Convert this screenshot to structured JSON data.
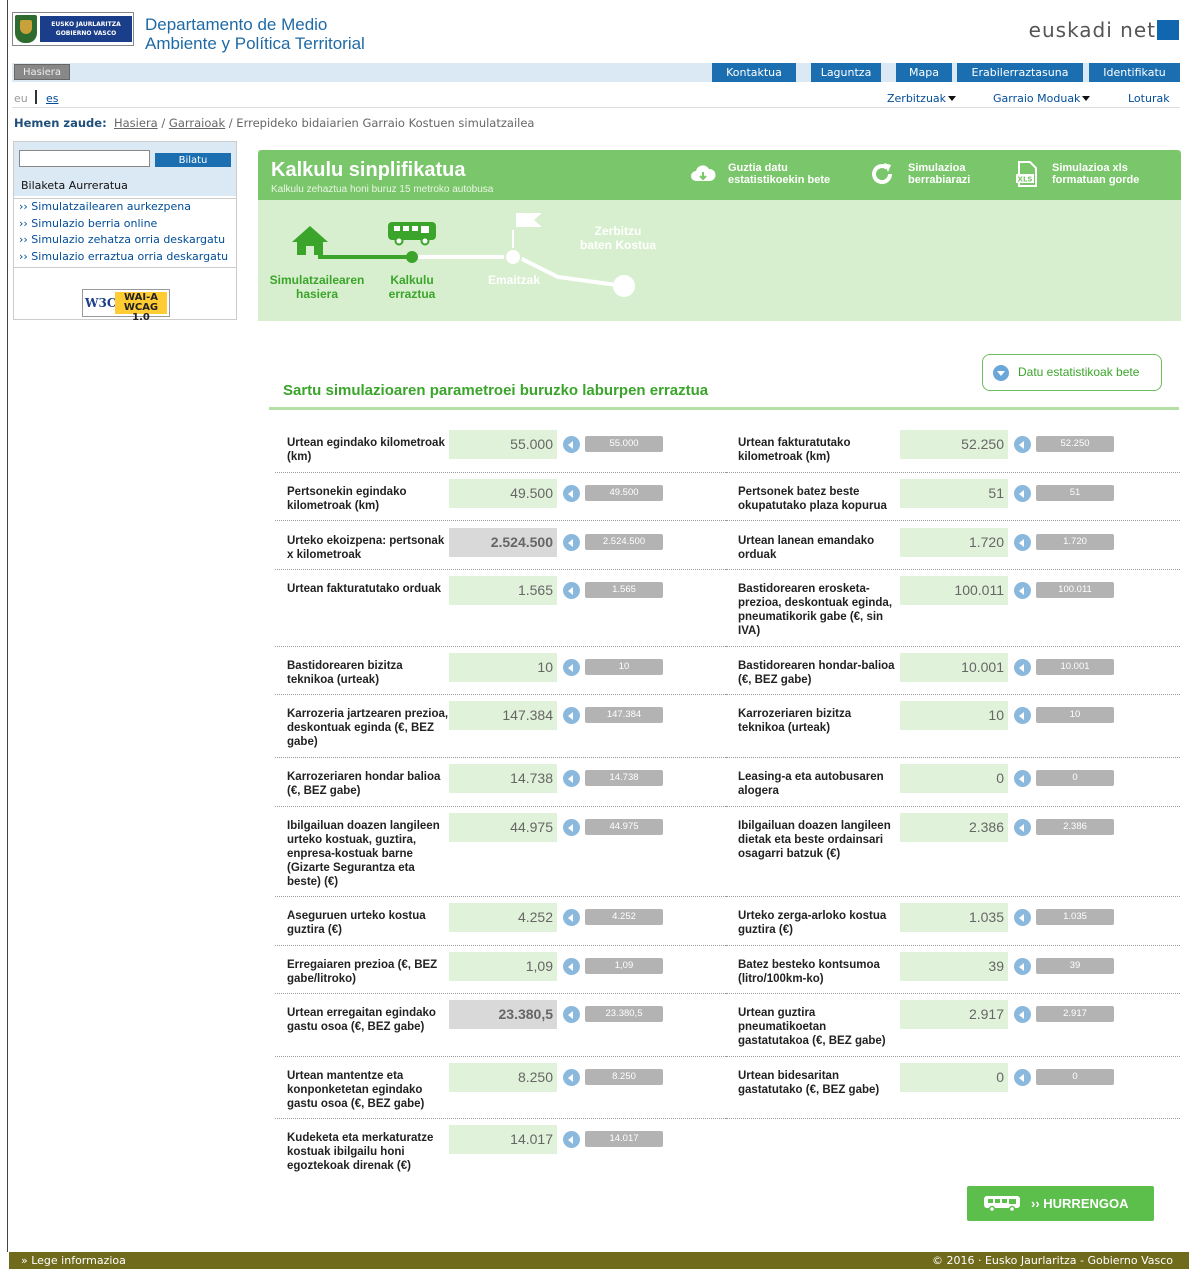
{
  "header": {
    "gov_logo_text": "EUSKO JAURLARITZA GOBIERNO VASCO",
    "dept_line1": "Departamento de Medio",
    "dept_line2": "Ambiente y Política Territorial",
    "portal_brand": "euskadi net"
  },
  "topnav": {
    "home": "Hasiera",
    "tabs": [
      "Kontaktua",
      "Laguntza",
      "Mapa",
      "Erabilerraztasuna",
      "Identifikatu"
    ]
  },
  "langbar": {
    "eu": "eu",
    "es": "es",
    "menus": [
      "Zerbitzuak",
      "Garraio Moduak",
      "Loturak"
    ]
  },
  "breadcrumb": {
    "label": "Hemen zaude:",
    "items": [
      "Hasiera",
      "Garraioak",
      "Errepideko bidaiarien Garraio Kostuen simulatzailea"
    ],
    "separator": "/"
  },
  "sidebar": {
    "search_button": "Bilatu",
    "search_value": "",
    "advanced_search": "Bilaketa Aurreratua",
    "links": [
      "›› Simulatzailearen aurkezpena",
      "›› Simulazio berria online",
      "›› Simulazio zehatza orria deskargatu",
      "›› Simulazio erraztua orria deskargatu"
    ],
    "wcag_w3c": "W3C",
    "wcag_line1": "WAI-A",
    "wcag_line2": "WCAG 1.0"
  },
  "panel": {
    "title": "Kalkulu sinplifikatua",
    "subtitle": "Kalkulu zehaztua honi buruz 15 metroko autobusa",
    "actions": [
      {
        "line1": "Guztia datu",
        "line2": "estatistikoekin bete"
      },
      {
        "line1": "Simulazioa",
        "line2": "berrabiarazi"
      },
      {
        "line1": "Simulazioa xls",
        "line2": "formatuan gorde"
      }
    ],
    "xls_icon_text": "XLS",
    "steps": [
      {
        "line1": "Simulatzailearen",
        "line2": "hasiera"
      },
      {
        "line1": "Kalkulu",
        "line2": "erraztua"
      },
      {
        "line1": "Emaitzak",
        "line2": ""
      },
      {
        "line1": "Zerbitzu",
        "line2": "baten Kostua"
      }
    ],
    "active_step_index": 1
  },
  "section": {
    "title": "Sartu simulazioaren parametroei buruzko laburpen erraztua",
    "fill_stats_button": "Datu estatistikoak bete"
  },
  "params": [
    {
      "label": "Urtean egindako kilometroak (km)",
      "value": "55.000",
      "slider": "55.000",
      "editable": true
    },
    {
      "label": "Urtean fakturatutako kilometroak (km)",
      "value": "52.250",
      "slider": "52.250",
      "editable": true
    },
    {
      "label": "Pertsonekin egindako kilometroak (km)",
      "value": "49.500",
      "slider": "49.500",
      "editable": true
    },
    {
      "label": "Pertsonek batez beste okupatutako plaza kopurua",
      "value": "51",
      "slider": "51",
      "editable": true
    },
    {
      "label": "Urteko ekoizpena: pertsonak x kilometroak",
      "value": "2.524.500",
      "slider": "2.524.500",
      "editable": false
    },
    {
      "label": "Urtean lanean emandako orduak",
      "value": "1.720",
      "slider": "1.720",
      "editable": true
    },
    {
      "label": "Urtean fakturatutako orduak",
      "value": "1.565",
      "slider": "1.565",
      "editable": true
    },
    {
      "label": "Bastidorearen erosketa-prezioa, deskontuak eginda, pneumatikorik gabe (€, sin IVA)",
      "value": "100.011",
      "slider": "100.011",
      "editable": true
    },
    {
      "label": "Bastidorearen bizitza teknikoa (urteak)",
      "value": "10",
      "slider": "10",
      "editable": true
    },
    {
      "label": "Bastidorearen hondar-balioa (€, BEZ gabe)",
      "value": "10.001",
      "slider": "10.001",
      "editable": true
    },
    {
      "label": "Karrozeria jartzearen prezioa, deskontuak eginda (€, BEZ gabe)",
      "value": "147.384",
      "slider": "147.384",
      "editable": true
    },
    {
      "label": "Karrozeriaren bizitza teknikoa (urteak)",
      "value": "10",
      "slider": "10",
      "editable": true
    },
    {
      "label": "Karrozeriaren hondar balioa (€, BEZ gabe)",
      "value": "14.738",
      "slider": "14.738",
      "editable": true
    },
    {
      "label": "Leasing-a eta autobusaren alogera",
      "value": "0",
      "slider": "0",
      "editable": true
    },
    {
      "label": "Ibilgailuan doazen langileen urteko kostuak, guztira, enpresa-kostuak barne (Gizarte Segurantza eta beste) (€)",
      "value": "44.975",
      "slider": "44.975",
      "editable": true
    },
    {
      "label": "Ibilgailuan doazen langileen dietak eta beste ordainsari osagarri batzuk (€)",
      "value": "2.386",
      "slider": "2.386",
      "editable": true
    },
    {
      "label": "Aseguruen urteko kostua guztira (€)",
      "value": "4.252",
      "slider": "4.252",
      "editable": true
    },
    {
      "label": "Urteko zerga-arloko kostua guztira (€)",
      "value": "1.035",
      "slider": "1.035",
      "editable": true
    },
    {
      "label": "Erregaiaren prezioa (€, BEZ gabe/litroko)",
      "value": "1,09",
      "slider": "1,09",
      "editable": true
    },
    {
      "label": "Batez besteko kontsumoa (litro/100km-ko)",
      "value": "39",
      "slider": "39",
      "editable": true
    },
    {
      "label": "Urtean erregaitan egindako gastu osoa (€, BEZ gabe)",
      "value": "23.380,5",
      "slider": "23.380,5",
      "editable": false
    },
    {
      "label": "Urtean guztira pneumatikoetan gastatutakoa (€, BEZ gabe)",
      "value": "2.917",
      "slider": "2.917",
      "editable": true
    },
    {
      "label": "Urtean mantentze eta konponketetan egindako gastu osoa (€, BEZ gabe)",
      "value": "8.250",
      "slider": "8.250",
      "editable": true
    },
    {
      "label": "Urtean bidesaritan gastatutako (€, BEZ gabe)",
      "value": "0",
      "slider": "0",
      "editable": true
    },
    {
      "label": "Kudeketa eta merkaturatze kostuak ibilgailu honi egoztekoak direnak (€)",
      "value": "14.017",
      "slider": "14.017",
      "editable": true
    }
  ],
  "next_button": "›› HURRENGOA",
  "footer": {
    "legal": "» Lege informazioa",
    "copyright": "© 2016 · Eusko Jaurlaritza - Gobierno Vasco"
  },
  "colors": {
    "green_header": "#7ac66a",
    "green_panel": "#d7efce",
    "green_title": "#3aa52a",
    "nav_blue": "#1b6fb0",
    "footer_olive": "#6f6a1c"
  }
}
